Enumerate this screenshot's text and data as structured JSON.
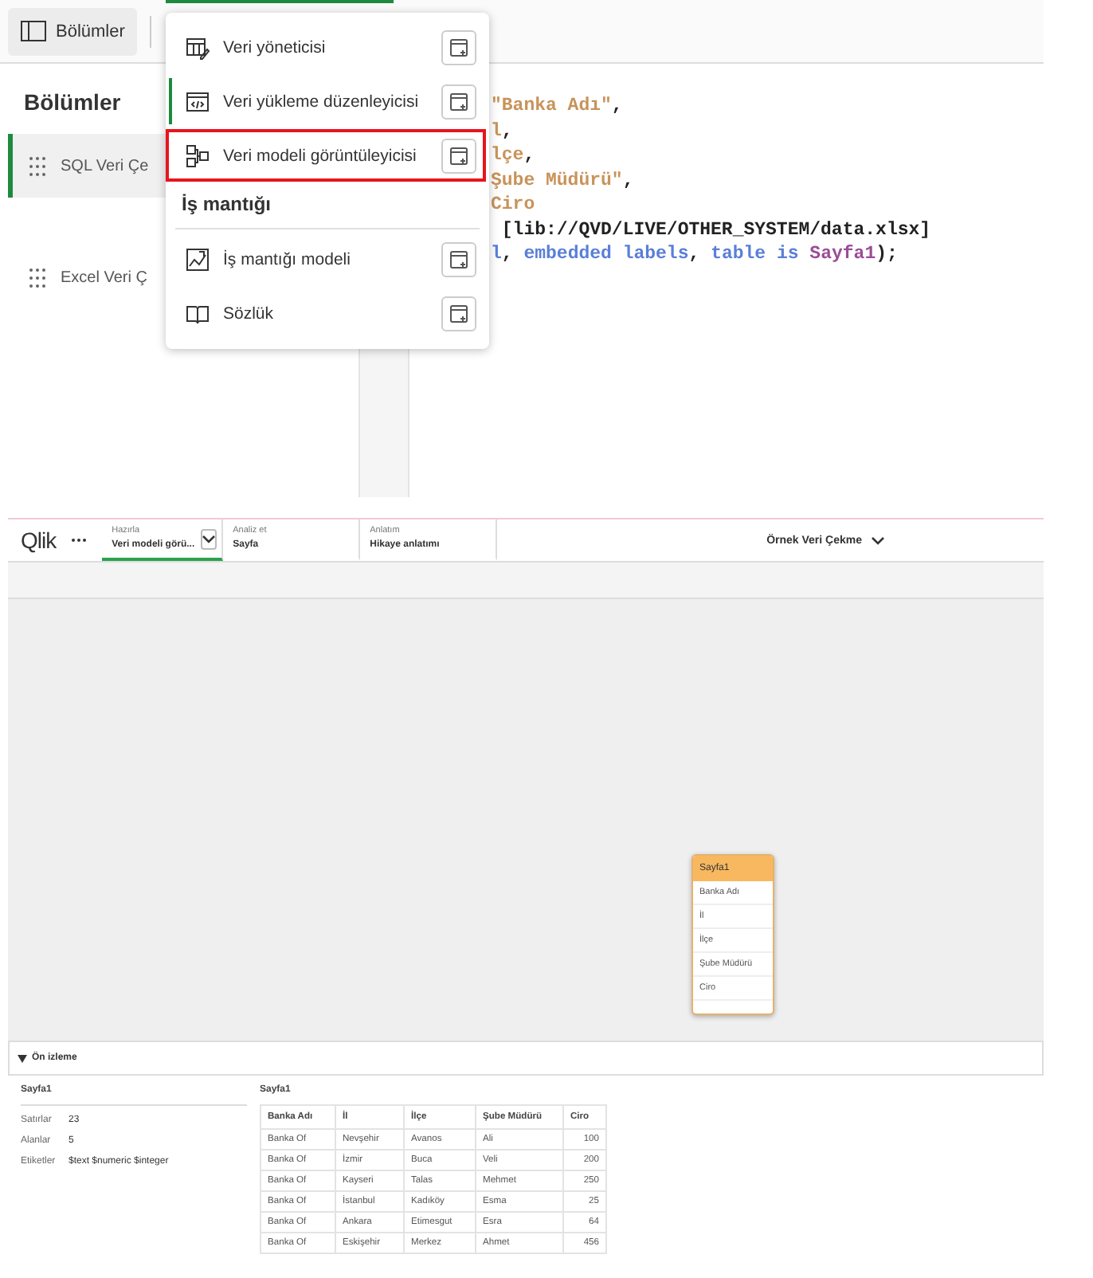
{
  "editor": {
    "sections_button": "Bölümler",
    "sidebar": {
      "title": "Bölümler",
      "items": [
        {
          "label": "SQL Veri Çe",
          "selected": true
        },
        {
          "label": "Excel Veri Ç",
          "selected": false
        }
      ]
    },
    "code_lines": [
      [
        {
          "kind": "string",
          "text": "\"Banka Adı\""
        },
        {
          "kind": "plain",
          "text": ","
        }
      ],
      [
        {
          "kind": "string",
          "text": "l"
        },
        {
          "kind": "plain",
          "text": ","
        }
      ],
      [
        {
          "kind": "string",
          "text": "lçe"
        },
        {
          "kind": "plain",
          "text": ","
        }
      ],
      [
        {
          "kind": "string",
          "text": "Şube Müdürü\""
        },
        {
          "kind": "plain",
          "text": ","
        }
      ],
      [
        {
          "kind": "string",
          "text": "Ciro"
        }
      ],
      [
        {
          "kind": "plain",
          "text": " [lib://QVD/LIVE/OTHER_SYSTEM/data.xlsx]"
        }
      ],
      [
        {
          "kind": "keyword",
          "text": "l"
        },
        {
          "kind": "plain",
          "text": ", "
        },
        {
          "kind": "keyword",
          "text": "embedded labels"
        },
        {
          "kind": "plain",
          "text": ", "
        },
        {
          "kind": "keyword",
          "text": "table is"
        },
        {
          "kind": "name",
          "text": " Sayfa1"
        },
        {
          "kind": "plain",
          "text": ");"
        }
      ]
    ],
    "menu": [
      {
        "kind": "item",
        "label": "Veri yöneticisi",
        "active": false,
        "highlighted": false
      },
      {
        "kind": "item",
        "label": "Veri yükleme düzenleyicisi",
        "active": true,
        "highlighted": false
      },
      {
        "kind": "item",
        "label": "Veri modeli görüntüleyicisi",
        "active": false,
        "highlighted": true
      },
      {
        "kind": "header",
        "label": "İş mantığı"
      },
      {
        "kind": "item",
        "label": "İş mantığı modeli",
        "active": false,
        "highlighted": false
      },
      {
        "kind": "item",
        "label": "Sözlük",
        "active": false,
        "highlighted": false
      }
    ]
  },
  "viewer": {
    "app_bar": {
      "logo": "Qlik",
      "tabs": [
        {
          "caption": "Hazırla",
          "label": "Veri modeli görü...",
          "selected": true,
          "dropdown": true
        },
        {
          "caption": "Analiz et",
          "label": "Sayfa",
          "selected": false,
          "dropdown": false
        },
        {
          "caption": "Anlatım",
          "label": "Hikaye anlatımı",
          "selected": false,
          "dropdown": false
        }
      ],
      "app_name": "Örnek Veri Çekme"
    },
    "model_table": {
      "title": "Sayfa1",
      "fields": [
        "Banka Adı",
        "İl",
        "İlçe",
        "Şube Müdürü",
        "Ciro"
      ]
    },
    "preview": {
      "title": "Ön izleme",
      "expanded": true,
      "summary": {
        "title": "Sayfa1",
        "rows": [
          {
            "label": "Satırlar",
            "value": "23"
          },
          {
            "label": "Alanlar",
            "value": "5"
          },
          {
            "label": "Etiketler",
            "value": "$text $numeric $integer"
          }
        ]
      },
      "table": {
        "title": "Sayfa1",
        "columns": [
          "Banka Adı",
          "İl",
          "İlçe",
          "Şube Müdürü",
          "Ciro"
        ],
        "rows": [
          [
            "Banka Of",
            "Nevşehir",
            "Avanos",
            "Ali",
            "100"
          ],
          [
            "Banka Of",
            "İzmir",
            "Buca",
            "Veli",
            "200"
          ],
          [
            "Banka Of",
            "Kayseri",
            "Talas",
            "Mehmet",
            "250"
          ],
          [
            "Banka Of",
            "İstanbul",
            "Kadıköy",
            "Esma",
            "25"
          ],
          [
            "Banka Of",
            "Ankara",
            "Etimesgut",
            "Esra",
            "64"
          ],
          [
            "Banka Of",
            "Eskişehir",
            "Merkez",
            "Ahmet",
            "456"
          ]
        ]
      }
    }
  }
}
